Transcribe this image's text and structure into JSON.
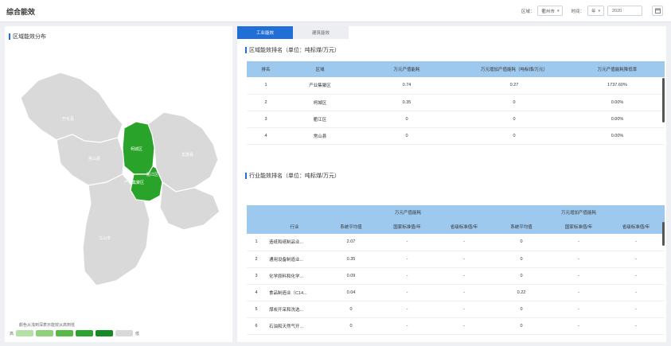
{
  "header": {
    "title": "综合能效",
    "region_label": "区域：",
    "region_value": "衢州市",
    "time_label": "时间：",
    "period_value": "年",
    "year_value": "2020",
    "calendar_icon": "calendar-icon"
  },
  "map_panel": {
    "title": "区域能效分布",
    "districts": [
      "开化县",
      "常山县",
      "柯城区",
      "衢江区",
      "产业集聚区",
      "龙游县",
      "江山市"
    ],
    "legend_title": "颜色从浅到深表示能效从高到低",
    "legend_high": "高",
    "legend_low": "低",
    "legend_colors": [
      "#b5e0a6",
      "#8fd17a",
      "#58b948",
      "#2fa32f",
      "#168a24",
      "#d9d9d9"
    ],
    "highlight_color": "#29a329"
  },
  "tabs": [
    {
      "label": "工业能效",
      "active": true
    },
    {
      "label": "建筑能效",
      "active": false
    }
  ],
  "region_rank": {
    "title": "区域能效排名（单位：吨标煤/万元）",
    "columns": [
      "排名",
      "区域",
      "万元产值能耗",
      "万元增加产值能耗（吨标煤/万元）",
      "万元产值能耗降低率"
    ],
    "rows": [
      [
        "1",
        "产业集聚区",
        "0.74",
        "0.27",
        "1737.60%"
      ],
      [
        "2",
        "柯城区",
        "0.35",
        "0",
        "0.00%"
      ],
      [
        "3",
        "衢江区",
        "0",
        "0",
        "0.00%"
      ],
      [
        "4",
        "常山县",
        "0",
        "0",
        "0.00%"
      ]
    ]
  },
  "industry_rank": {
    "title": "行业能效排名（单位：吨标煤/万元）",
    "group1": "万元产值能耗",
    "group2": "万元增加产值能耗",
    "col_industry": "行业",
    "sub_columns": [
      "系统平均值",
      "国家标准值/年",
      "省级标准值/年",
      "系统平均值",
      "国家标准值/年",
      "省级标准值/年"
    ],
    "rows": [
      [
        "1",
        "造纸和纸制品业...",
        "2.07",
        "-",
        "-",
        "0",
        "-",
        "-"
      ],
      [
        "2",
        "通用设备制造业...",
        "0.35",
        "-",
        "-",
        "0",
        "-",
        "-"
      ],
      [
        "3",
        "化学原料和化学...",
        "0.09",
        "-",
        "-",
        "0",
        "-",
        "-"
      ],
      [
        "4",
        "食品制造业（C14...",
        "0.04",
        "-",
        "-",
        "0.22",
        "-",
        "-"
      ],
      [
        "5",
        "煤炭开采和洗选...",
        "0",
        "-",
        "-",
        "0",
        "-",
        "-"
      ],
      [
        "6",
        "石油和天然气开...",
        "0",
        "-",
        "-",
        "0",
        "-",
        "-"
      ]
    ]
  },
  "colors": {
    "accent": "#1f6fd6",
    "table_header": "#9ec9ee",
    "map_gray": "#d9d9d9"
  }
}
